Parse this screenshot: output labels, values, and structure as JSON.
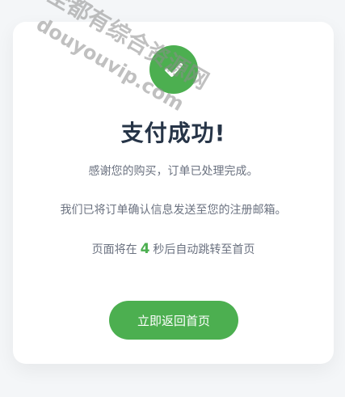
{
  "status": {
    "icon": "check-icon",
    "title": "支付成功!"
  },
  "messages": {
    "thanks": "感谢您的购买，订单已处理完成。",
    "email_notice": "我们已将订单确认信息发送至您的注册邮箱。"
  },
  "countdown": {
    "prefix": "页面将在",
    "seconds": "4",
    "suffix": "秒后自动跳转至首页"
  },
  "actions": {
    "home_label": "立即返回首页"
  },
  "watermark": {
    "line1": "全都有综合资源网",
    "line2": "douyouvip.com"
  },
  "colors": {
    "accent": "#4caf50",
    "title": "#263447",
    "text": "#6b7280",
    "background": "#f4f6f8"
  }
}
